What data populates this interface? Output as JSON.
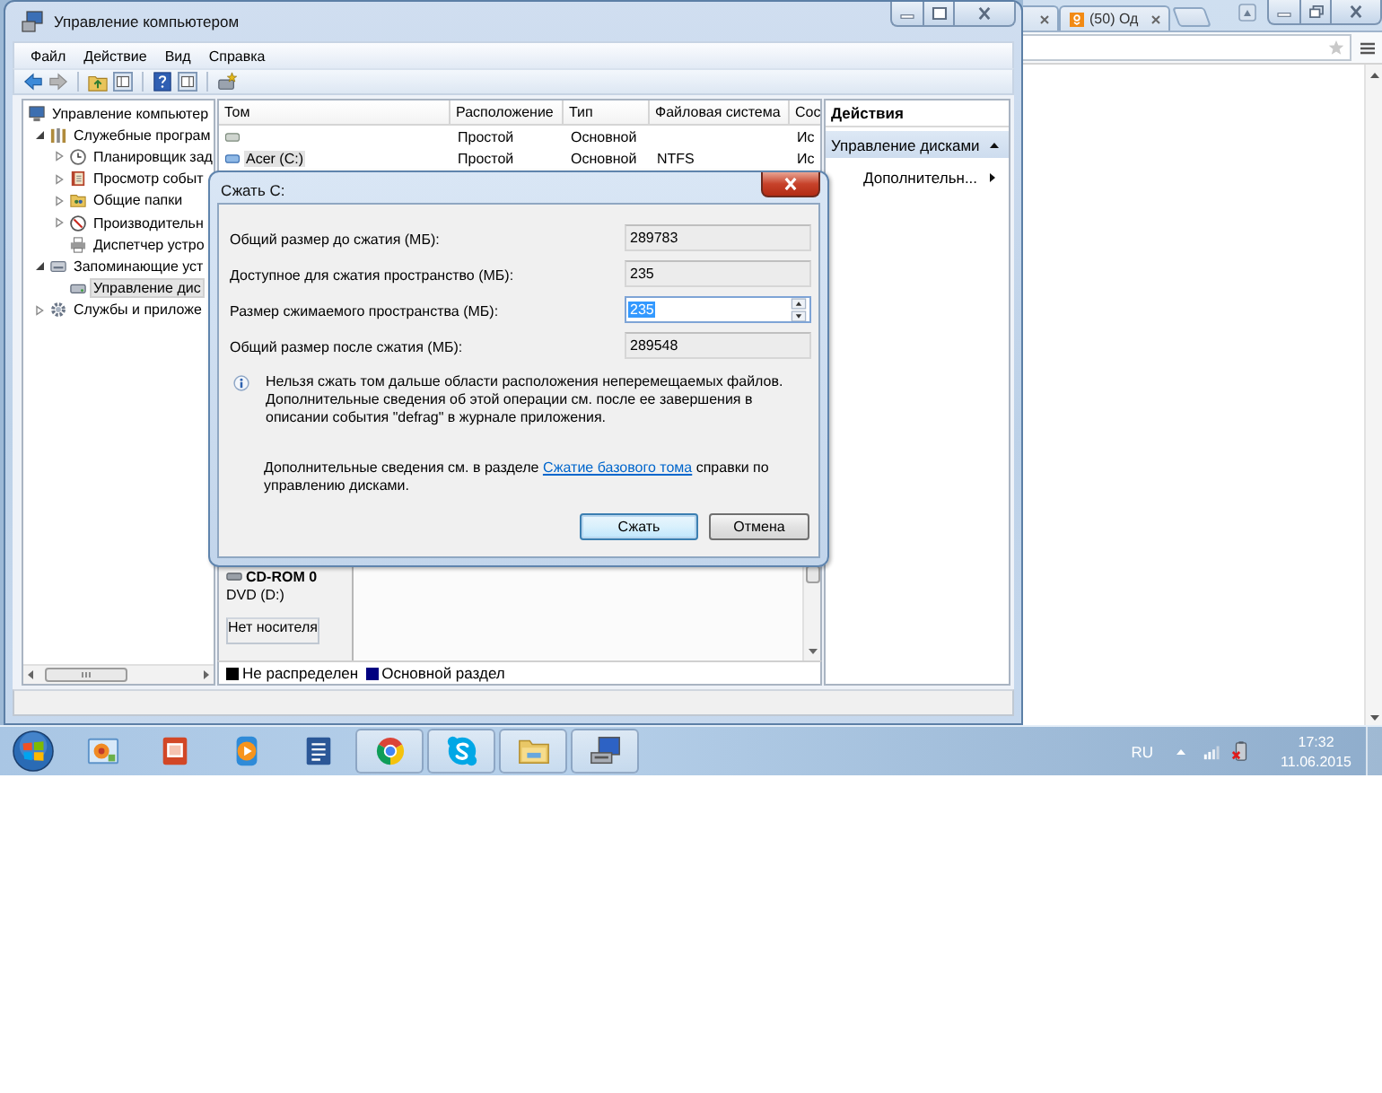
{
  "browser_window": {
    "tab": {
      "title": "(50) Од"
    }
  },
  "computer_management": {
    "title": "Управление компьютером",
    "menu": [
      "Файл",
      "Действие",
      "Вид",
      "Справка"
    ],
    "tree": [
      {
        "label": "Управление компьютер",
        "kind": "computer",
        "selected": false,
        "children": [
          {
            "label": "Служебные програм",
            "kind": "tools",
            "expanded": true,
            "selected": false,
            "children": [
              {
                "label": "Планировщик зад",
                "kind": "clock",
                "expanded": false,
                "selected": false
              },
              {
                "label": "Просмотр событ",
                "kind": "log",
                "expanded": false,
                "selected": false
              },
              {
                "label": "Общие папки",
                "kind": "folder",
                "expanded": false,
                "selected": false
              },
              {
                "label": "Производительн",
                "kind": "gauge",
                "expanded": false,
                "selected": false
              },
              {
                "label": "Диспетчер устро",
                "kind": "devices",
                "selected": false
              }
            ]
          },
          {
            "label": "Запоминающие уст",
            "kind": "storage",
            "expanded": true,
            "selected": false,
            "children": [
              {
                "label": "Управление дис",
                "kind": "disk",
                "selected": true
              }
            ]
          },
          {
            "label": "Службы и приложе",
            "kind": "services",
            "expanded": false,
            "selected": false
          }
        ]
      }
    ],
    "volumes": {
      "columns": [
        "Том",
        "Расположение",
        "Тип",
        "Файловая система",
        "Сос"
      ],
      "rows": [
        {
          "layout": "Простой",
          "type": "Основной",
          "column_5": "Ис",
          "selected": false
        },
        {
          "volume": "Acer (C:)",
          "layout": "Простой",
          "type": "Основной",
          "file_system": "NTFS",
          "column_5": "Ис",
          "selected": true
        }
      ]
    },
    "disks": [
      {
        "name": "CD-ROM 0",
        "drive": "DVD (D:)",
        "status": "Нет носителя"
      }
    ],
    "legend": [
      {
        "label": "Не распределен",
        "color": "#000000"
      },
      {
        "label": "Основной раздел",
        "color": "#000080"
      }
    ],
    "actions": {
      "title": "Действия",
      "sections": [
        {
          "label": "Управление дисками",
          "expanded": true,
          "items": [
            "Дополнительн..."
          ]
        }
      ]
    }
  },
  "shrink_dialog": {
    "title": "Сжать С:",
    "fields": [
      {
        "label": "Общий размер до сжатия (МБ):",
        "value": "289783",
        "kind": "readonly"
      },
      {
        "label": "Доступное для сжатия пространство (МБ):",
        "value": "235",
        "kind": "readonly"
      },
      {
        "label": "Размер сжимаемого пространства (МБ):",
        "value": "235",
        "kind": "spinner",
        "text_selected": true
      },
      {
        "label": "Общий размер после сжатия (МБ):",
        "value": "289548",
        "kind": "readonly"
      }
    ],
    "info": "Нельзя сжать том дальше области расположения неперемещаемых файлов. Дополнительные сведения об этой операции см. после ее завершения в описании события \"defrag\" в журнале приложения.",
    "help": {
      "text_before": "Дополнительные сведения см. в разделе",
      "link": "Сжатие базового тома",
      "text_after": "справки по управлению дисками."
    },
    "buttons": [
      {
        "label": "Сжать",
        "default": true
      },
      {
        "label": "Отмена",
        "default": false
      }
    ]
  },
  "taskbar": {
    "apps": [
      {
        "kind": "photos",
        "running": false
      },
      {
        "kind": "slides",
        "running": false
      },
      {
        "kind": "media",
        "running": false
      },
      {
        "kind": "word",
        "running": false
      },
      {
        "kind": "browser",
        "running": true
      },
      {
        "kind": "chat",
        "running": true
      },
      {
        "kind": "folder",
        "running": true
      },
      {
        "kind": "manager",
        "running": true
      }
    ],
    "tray": {
      "language": "RU",
      "time": "17:32",
      "date": "11.06.2015"
    }
  }
}
